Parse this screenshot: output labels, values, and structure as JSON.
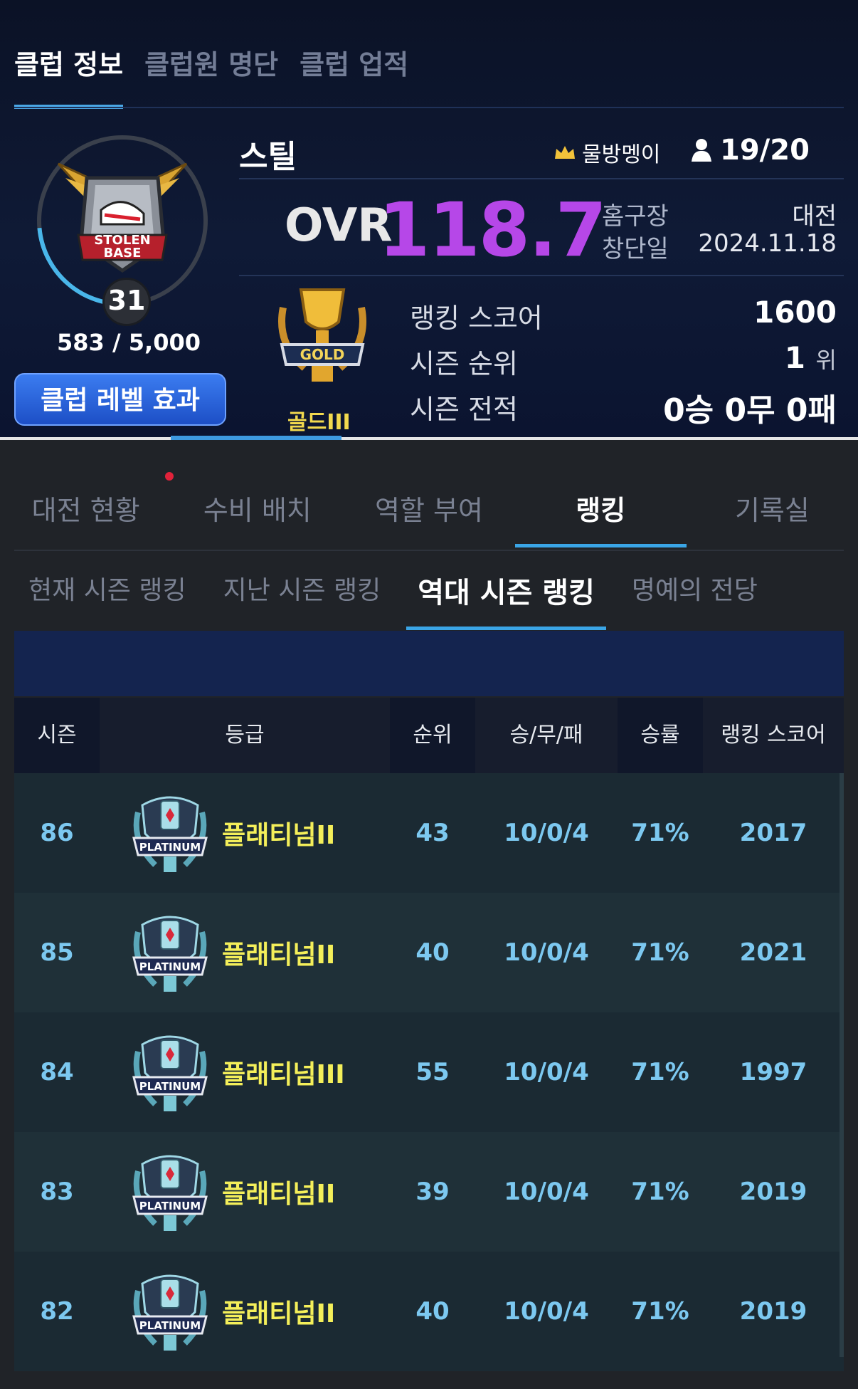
{
  "club_tabs": [
    "클럽 정보",
    "클럽원 명단",
    "클럽 업적"
  ],
  "club": {
    "name": "스틸",
    "master_name": "물방멩이",
    "members": "19/20",
    "level": "31",
    "exp": "583 / 5,000",
    "level_button": "클럽 레벨 효과",
    "emblem_text": [
      "STOLEN",
      "BASE"
    ],
    "ovr_label": "OVR",
    "ovr_value": "118.7",
    "home_label": "홈구장",
    "home_value": "대전",
    "founded_label": "창단일",
    "founded_value": "2024.11.18",
    "grade_name": "골드III",
    "grade_emblem_text": "GOLD",
    "ranking_score_label": "랭킹 스코어",
    "ranking_score_value": "1600",
    "season_rank_label": "시즌 순위",
    "season_rank_value": "1",
    "season_rank_unit": "위",
    "season_record_label": "시즌 전적",
    "season_record_value": "0승 0무 0패"
  },
  "main_tabs": [
    "대전 현황",
    "수비 배치",
    "역할 부여",
    "랭킹",
    "기록실"
  ],
  "main_tab_active": 3,
  "sub_tabs": [
    "현재 시즌 랭킹",
    "지난 시즌 랭킹",
    "역대 시즌 랭킹",
    "명예의 전당"
  ],
  "sub_tab_active": 2,
  "table": {
    "headers": [
      "시즌",
      "등급",
      "순위",
      "승/무/패",
      "승률",
      "랭킹 스코어"
    ],
    "emblem_text": "PLATINUM",
    "rows": [
      {
        "season": "86",
        "grade": "플래티넘II",
        "rank": "43",
        "record": "10/0/4",
        "rate": "71%",
        "score": "2017"
      },
      {
        "season": "85",
        "grade": "플래티넘II",
        "rank": "40",
        "record": "10/0/4",
        "rate": "71%",
        "score": "2021"
      },
      {
        "season": "84",
        "grade": "플래티넘III",
        "rank": "55",
        "record": "10/0/4",
        "rate": "71%",
        "score": "1997"
      },
      {
        "season": "83",
        "grade": "플래티넘II",
        "rank": "39",
        "record": "10/0/4",
        "rate": "71%",
        "score": "2019"
      },
      {
        "season": "82",
        "grade": "플래티넘II",
        "rank": "40",
        "record": "10/0/4",
        "rate": "71%",
        "score": "2019"
      }
    ]
  },
  "colors": {
    "ovr": "#b647e8",
    "accent": "#3aa5e6",
    "grade_text": "#f4ef5a",
    "table_text": "#7cc8f0"
  }
}
